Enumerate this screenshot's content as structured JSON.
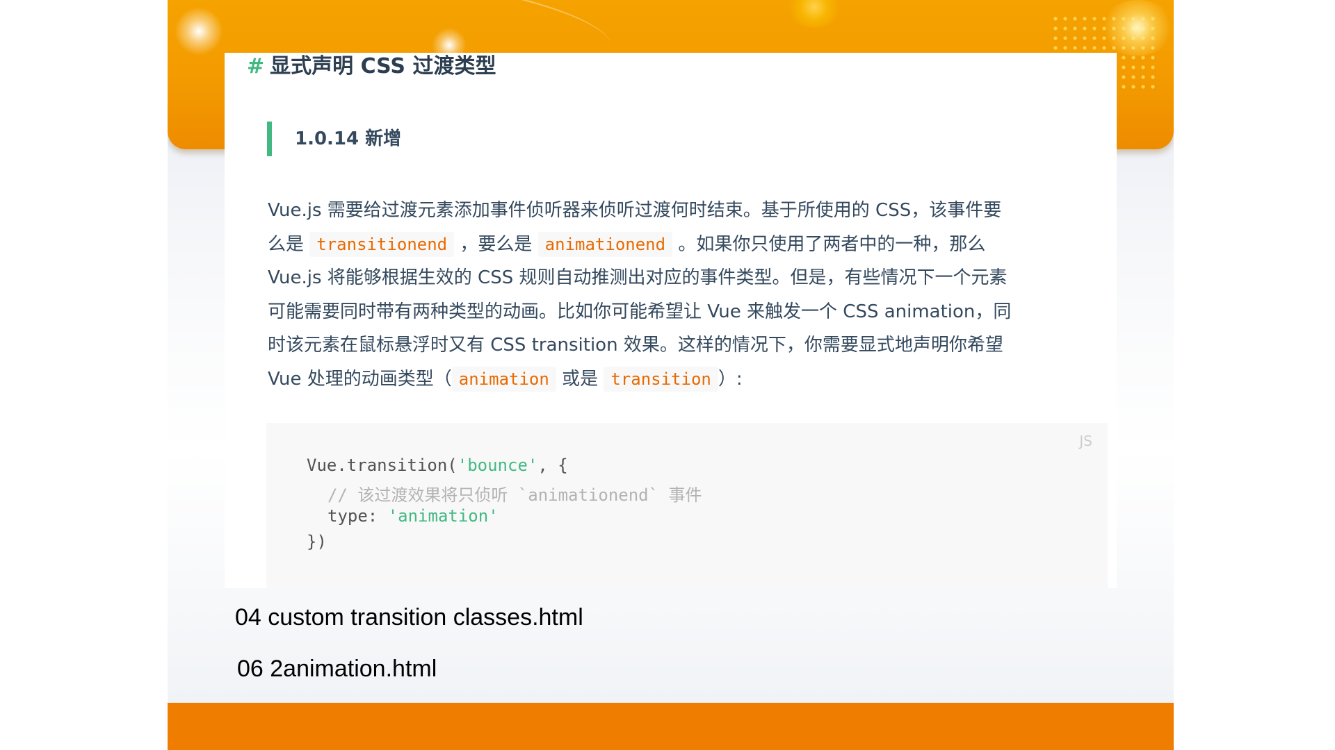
{
  "heading": {
    "hash": "#",
    "title": "显式声明 CSS 过渡类型"
  },
  "note": "1.0.14 新增",
  "paragraph": {
    "l1": "Vue.js 需要给过渡元素添加事件侦听器来侦听过渡何时结束。基于所使用的 CSS，该事件要",
    "l2a": "么是",
    "code_transitionend": "transitionend",
    "l2b": "，要么是",
    "code_animationend": "animationend",
    "l2c": "。如果你只使用了两者中的一种，那么",
    "l3": "Vue.js 将能够根据生效的 CSS 规则自动推测出对应的事件类型。但是，有些情况下一个元素",
    "l4": "可能需要同时带有两种类型的动画。比如你可能希望让 Vue 来触发一个 CSS animation，同",
    "l5": "时该元素在鼠标悬浮时又有 CSS transition 效果。这样的情况下，你需要显式地声明你希望",
    "l6a": "Vue 处理的动画类型（",
    "code_animation": "animation",
    "l6b": "或是",
    "code_transition": "transition",
    "l6c": "）:"
  },
  "code_block": {
    "lang": "JS",
    "line1_pre": "Vue.transition(",
    "line1_str": "'bounce'",
    "line1_post": ", {",
    "line2_comment": "// 该过渡效果将只侦听 `animationend` 事件",
    "line3_key": "type: ",
    "line3_str": "'animation'",
    "line4": "})"
  },
  "captions": {
    "caption1": "04 custom transition classes.html",
    "caption2": "06 2animation.html"
  },
  "colors": {
    "accent_green": "#42b983",
    "inline_code": "#e96900",
    "band_orange": "#ef7d00"
  }
}
